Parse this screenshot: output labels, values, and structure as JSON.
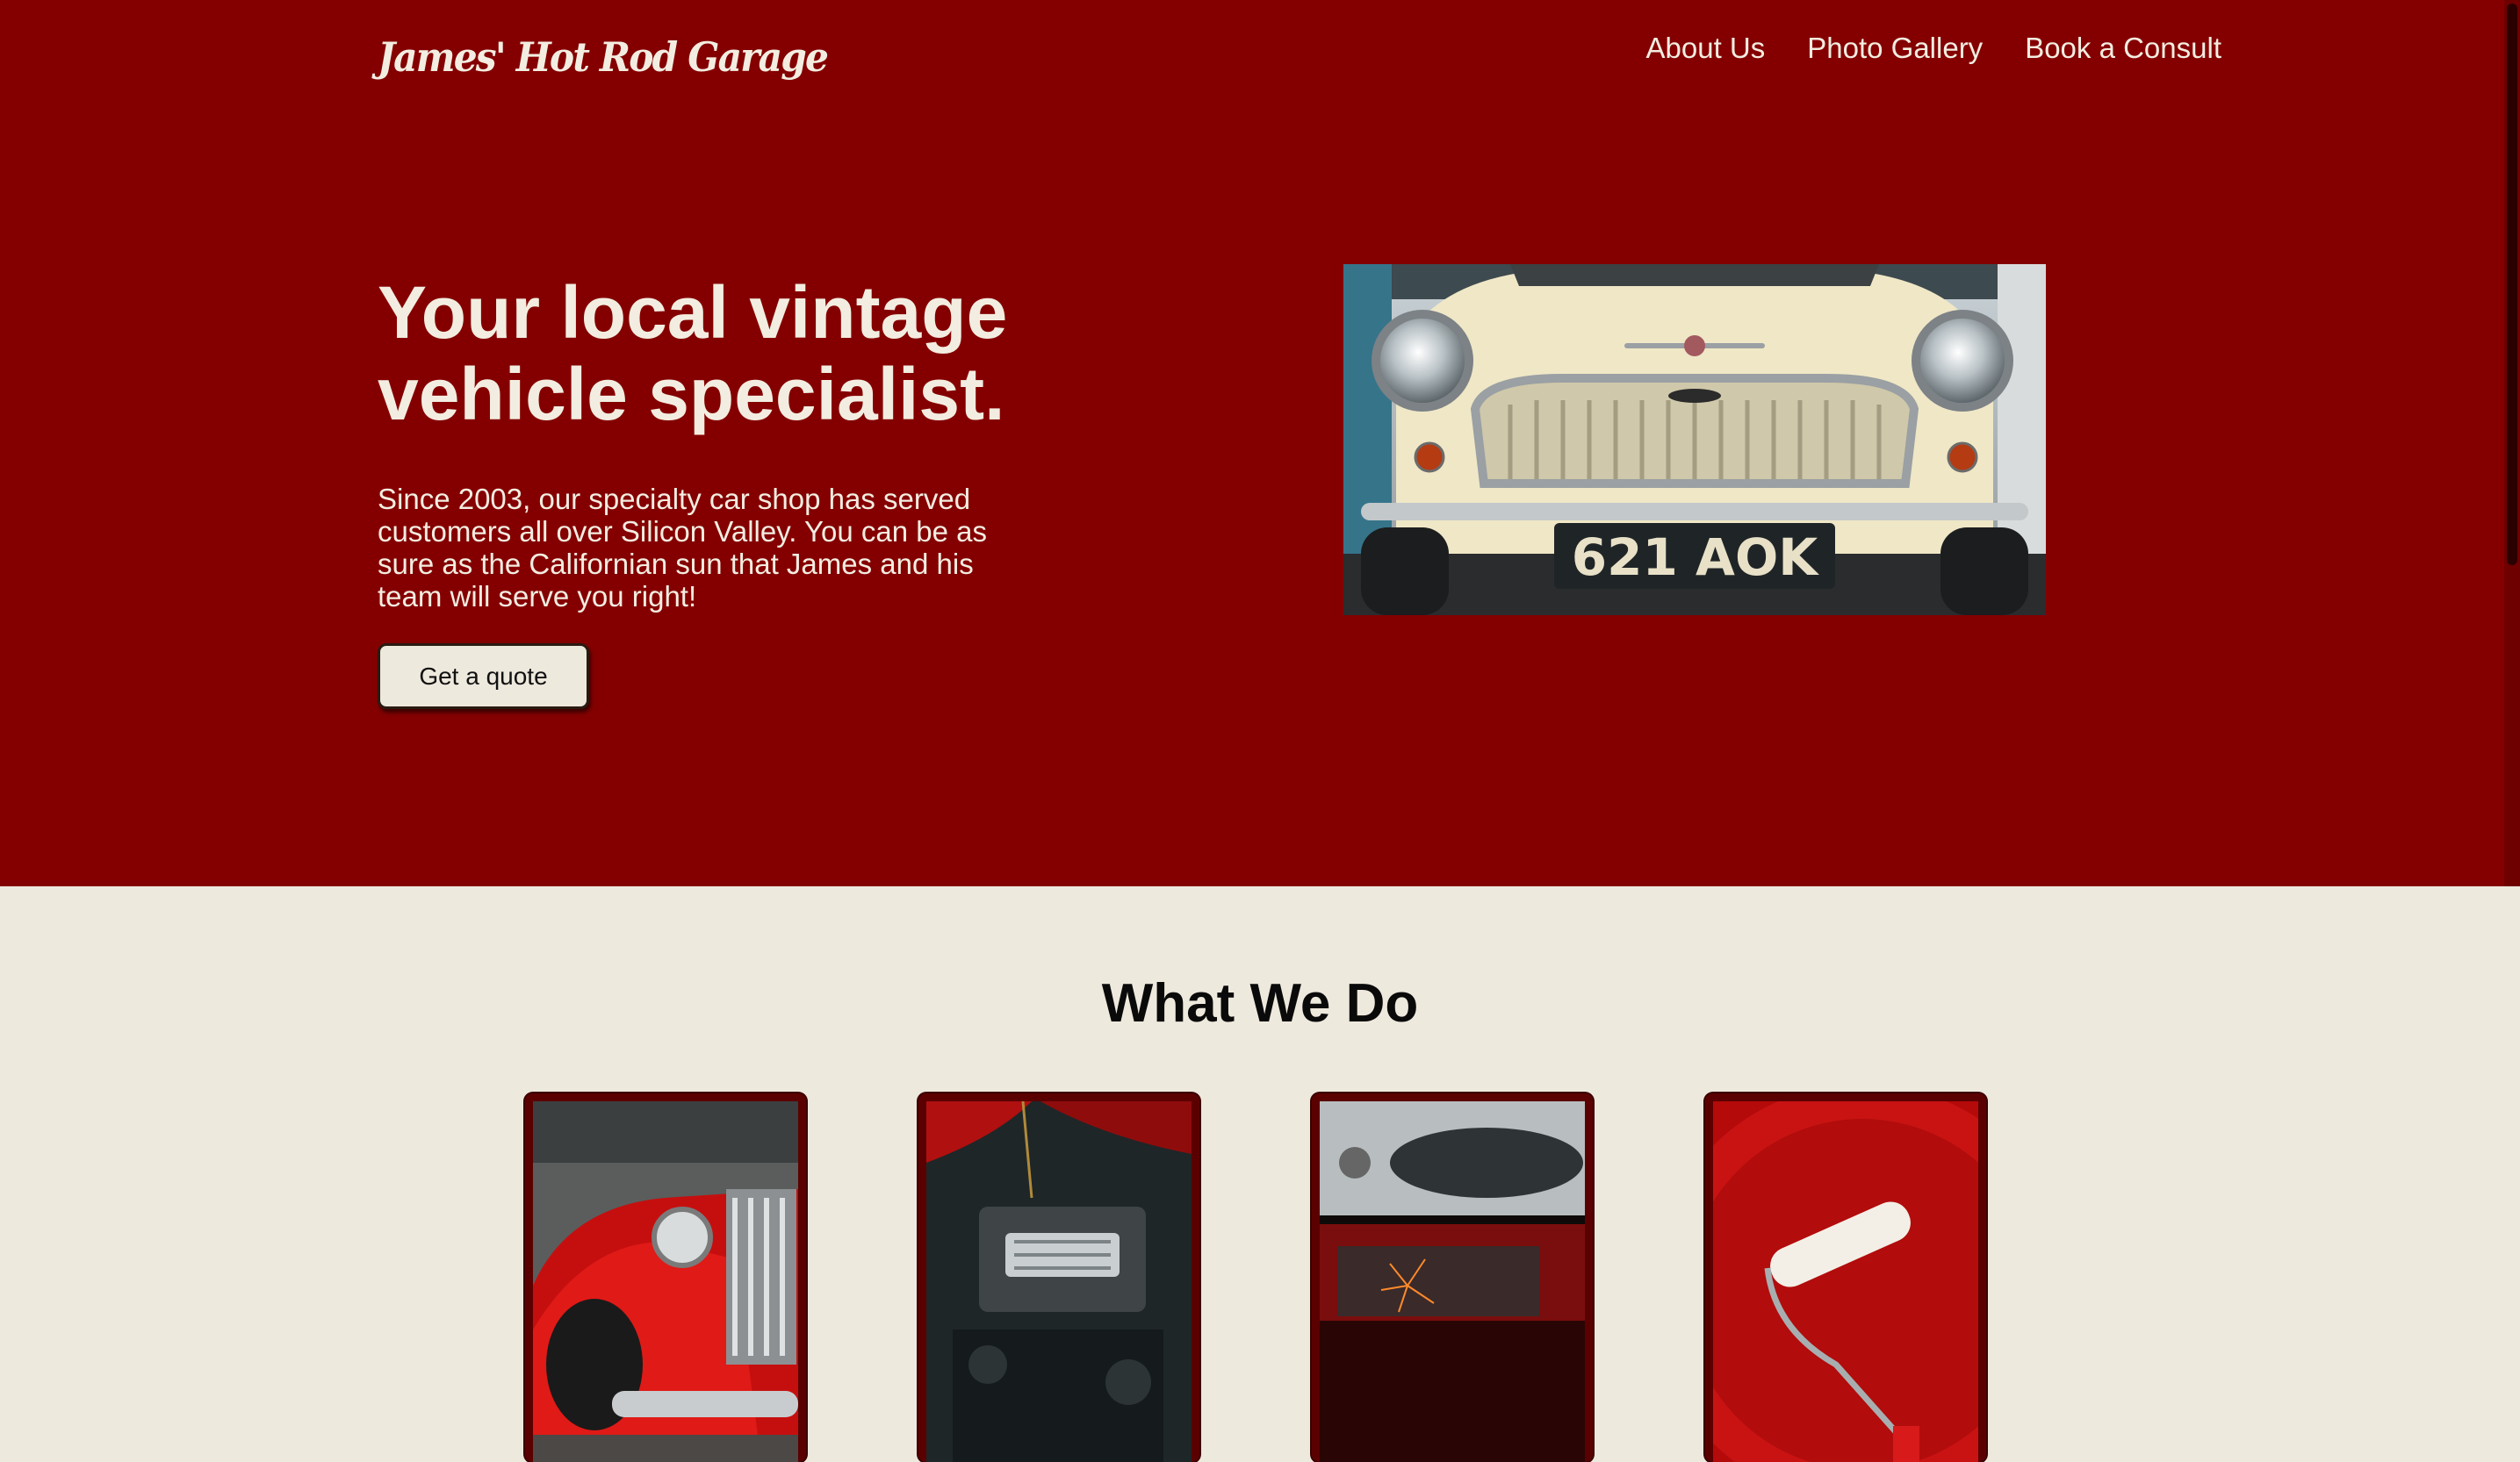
{
  "header": {
    "logo": "James' Hot Rod Garage",
    "nav": [
      "About Us",
      "Photo Gallery",
      "Book a Consult"
    ]
  },
  "hero": {
    "title": "Your local vintage vehicle specialist.",
    "text": "Since 2003, our specialty car shop has served customers all over Silicon Valley. You can be as sure as the Californian sun that James and his team will serve you right!",
    "button_label": "Get a quote",
    "plate": "621 AOK"
  },
  "services": {
    "title": "What We Do",
    "cards": [
      {
        "image": "red-vintage-truck-photo"
      },
      {
        "image": "engine-bay-photo"
      },
      {
        "image": "welding-sparks-photo"
      },
      {
        "image": "paint-roller-photo"
      }
    ]
  },
  "colors": {
    "primary": "#840000",
    "cream": "#EEE9DD",
    "text_light": "#F3EDE1"
  }
}
